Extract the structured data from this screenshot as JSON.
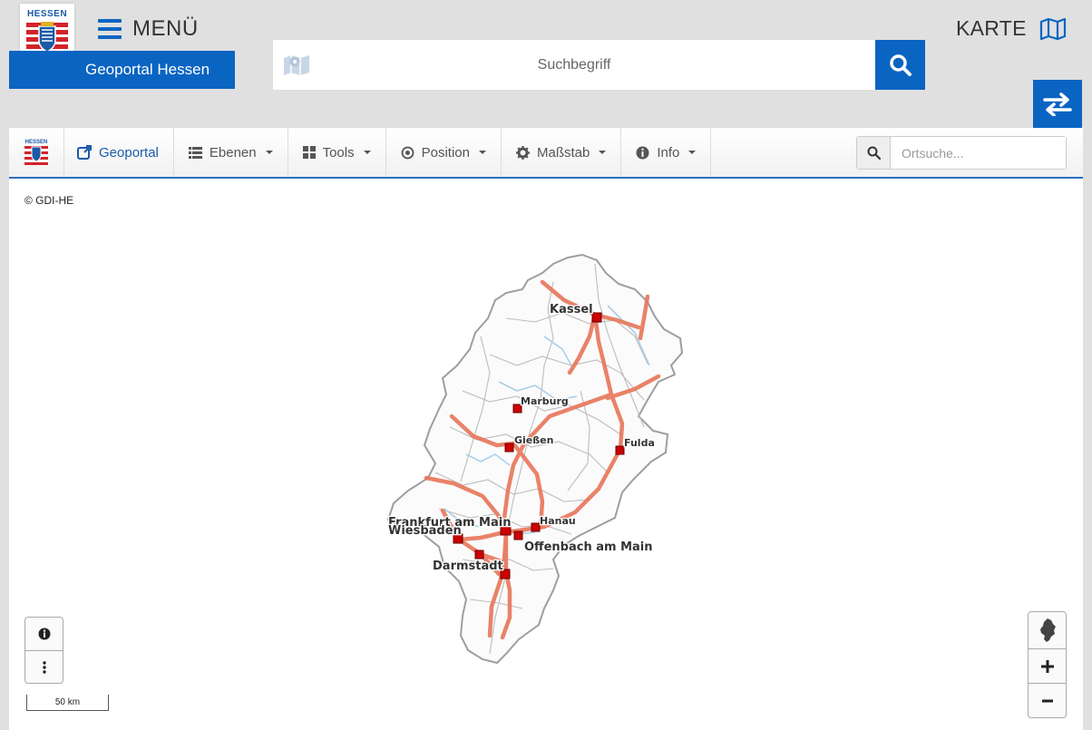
{
  "header": {
    "logo_text": "HESSEN",
    "menu_label": "MENÜ",
    "brand_label": "Geoportal Hessen",
    "search_placeholder": "Suchbegriff",
    "map_label": "KARTE"
  },
  "toolbar": {
    "logo_text": "HESSEN",
    "geoportal_label": "Geoportal",
    "ebenen_label": "Ebenen",
    "tools_label": "Tools",
    "position_label": "Position",
    "massstab_label": "Maßstab",
    "info_label": "Info",
    "ort_placeholder": "Ortsuche..."
  },
  "map": {
    "attribution": "© GDI-HE",
    "scale_label": "50 km",
    "cities": [
      {
        "name": "Kassel"
      },
      {
        "name": "Marburg"
      },
      {
        "name": "Gießen"
      },
      {
        "name": "Fulda"
      },
      {
        "name": "Hanau"
      },
      {
        "name": "Frankfurt am Main"
      },
      {
        "name": "Wiesbaden"
      },
      {
        "name": "Offenbach am Main"
      },
      {
        "name": "Darmstadt"
      }
    ]
  },
  "colors": {
    "primary": "#0a64c2",
    "road": "#e8765a",
    "border": "#9e9e9e",
    "river": "#a9cfe8",
    "city_marker": "#cc0000"
  }
}
